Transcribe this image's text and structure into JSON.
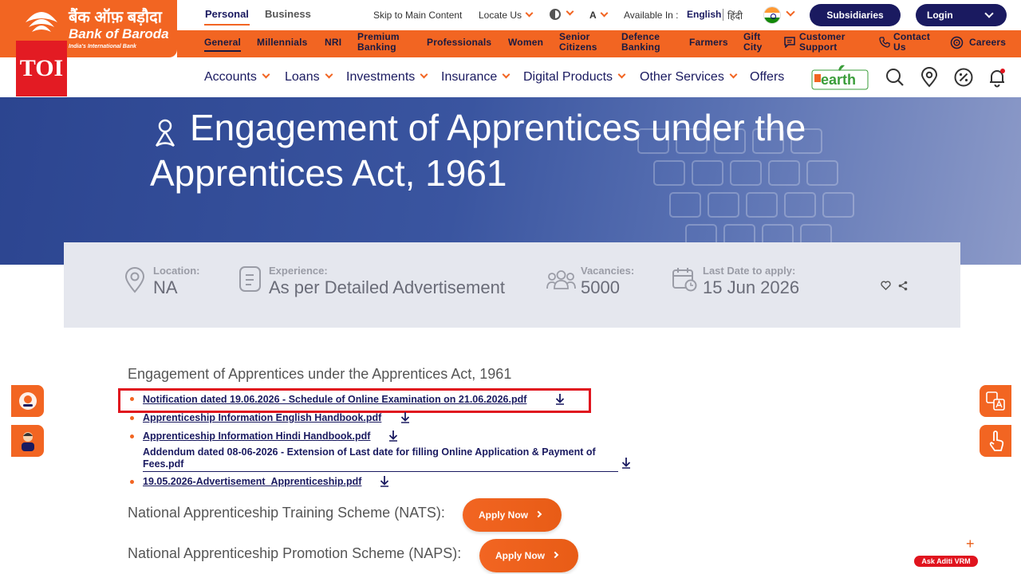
{
  "logo": {
    "hindi": "बैंक ऑफ़ बड़ौदा",
    "english": "Bank of Baroda",
    "tagline": "India's International Bank"
  },
  "toi_badge": "TOI",
  "segments": [
    "Personal",
    "Business"
  ],
  "utility": {
    "skip": "Skip to Main Content",
    "locate": "Locate Us",
    "font_size": "A",
    "available_in": "Available In :",
    "lang_english": "English",
    "lang_hindi": "हिंदी",
    "subsidiaries": "Subsidiaries",
    "login": "Login"
  },
  "orange_menu": {
    "general": "General",
    "millennials": "Millennials",
    "nri": "NRI",
    "premium_1": "Premium",
    "premium_2": "Banking",
    "professionals": "Professionals",
    "women": "Women",
    "senior_1": "Senior",
    "senior_2": "Citizens",
    "defence_1": "Defence",
    "defence_2": "Banking",
    "farmers": "Farmers",
    "gift_1": "Gift",
    "gift_2": "City",
    "support_1": "Customer",
    "support_2": "Support",
    "contact_1": "Contact",
    "contact_2": "Us",
    "careers": "Careers"
  },
  "main_nav": [
    "Accounts",
    "Loans",
    "Investments",
    "Insurance",
    "Digital Products",
    "Other Services",
    "Offers"
  ],
  "earth_badge": "earth",
  "hero": {
    "title": "Engagement of Apprentices under the Apprentices Act, 1961"
  },
  "info": {
    "location_label": "Location:",
    "location_value": "NA",
    "experience_label": "Experience:",
    "experience_value": "As per Detailed Advertisement",
    "vacancies_label": "Vacancies:",
    "vacancies_value": "5000",
    "lastdate_label": "Last Date to apply:",
    "lastdate_value": "15 Jun 2026"
  },
  "content": {
    "section_heading": "Engagement of Apprentices under the Apprentices Act, 1961",
    "documents": [
      "Notification dated 19.06.2026 - Schedule of Online Examination on 21.06.2026.pdf",
      "Apprenticeship Information English Handbook.pdf",
      "Apprenticeship Information Hindi Handbook.pdf",
      "Addendum dated 08-06-2026 - Extension of Last date for filling Online Application & Payment of Fees.pdf",
      "19.05.2026-Advertisement_Apprenticeship.pdf"
    ],
    "nats_label": "National Apprenticeship Training Scheme (NATS):",
    "naps_label": "National Apprenticeship Promotion Scheme (NAPS):",
    "apply_label": "Apply Now"
  },
  "aditi_label": "Ask Aditi VRM",
  "colors": {
    "brand_orange": "#f26522",
    "navy": "#1a1a60",
    "highlight_red": "#e0141e"
  }
}
